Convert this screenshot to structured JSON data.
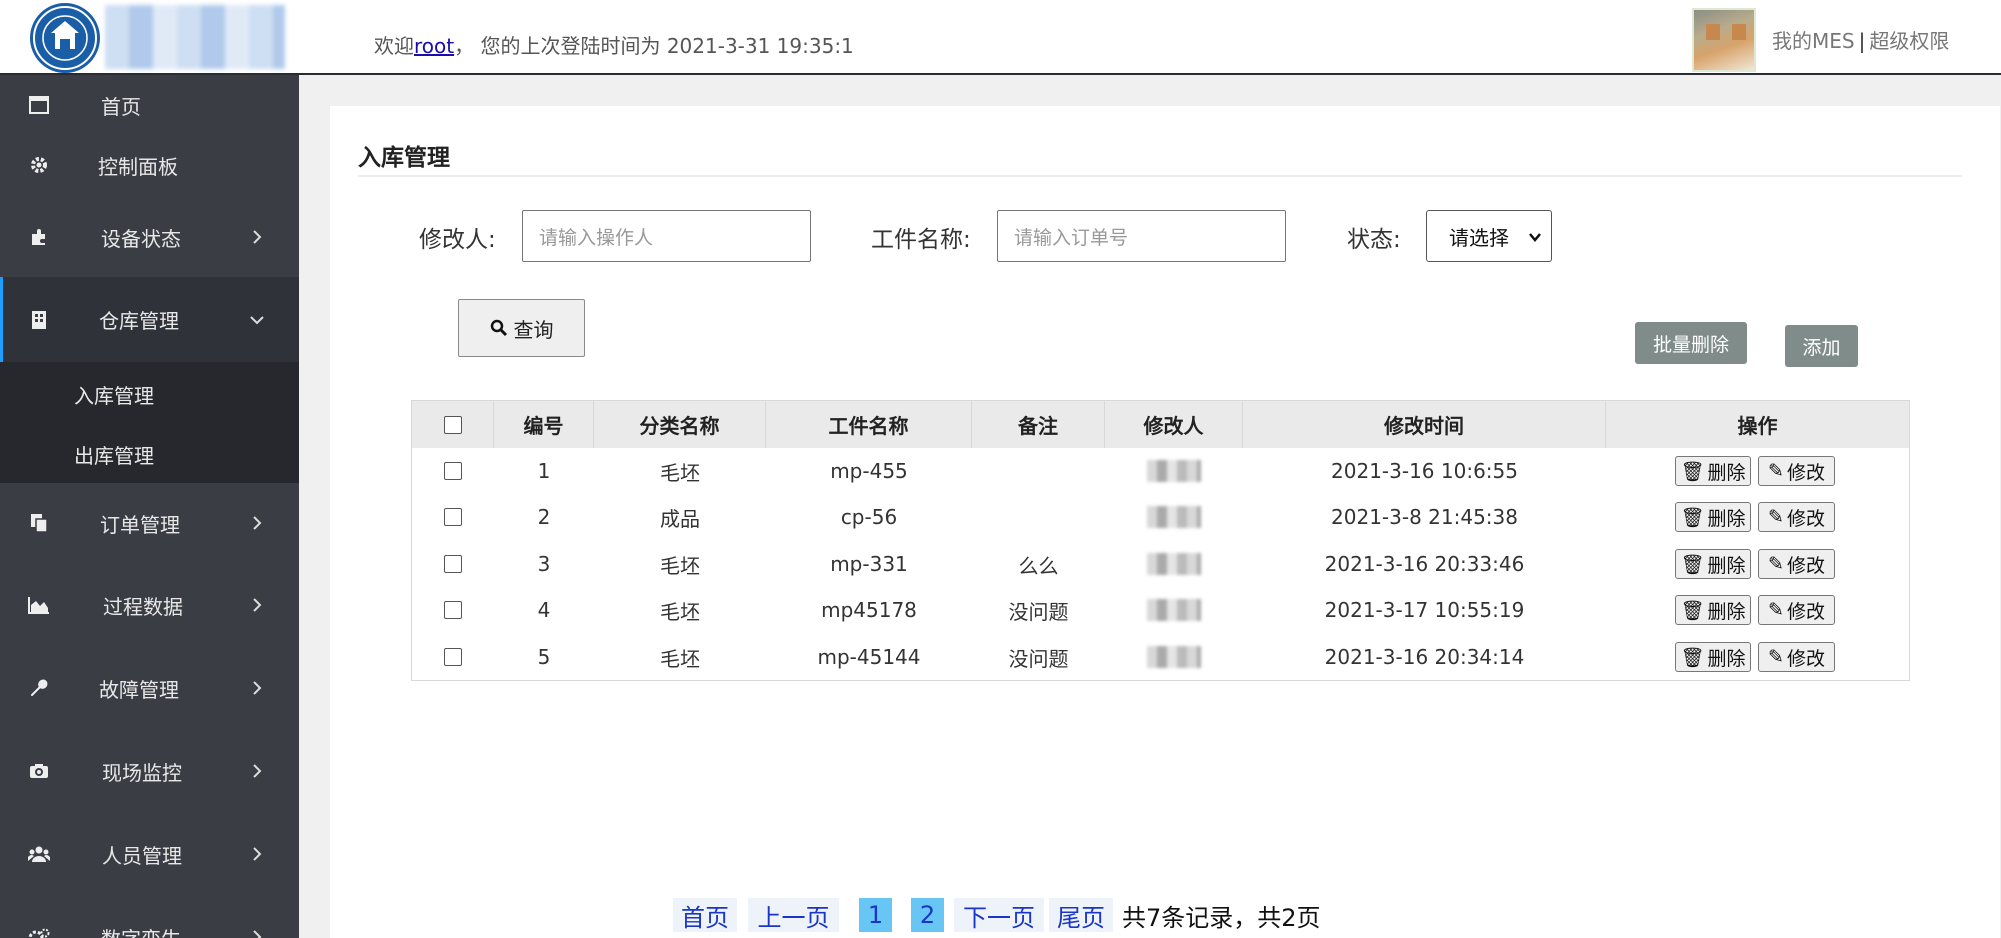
{
  "header": {
    "welcome_prefix": "欢迎",
    "user": "root",
    "welcome_suffix": "， 您的上次登陆时间为 2021-3-31 19:35:1",
    "my_mes": "我的MES",
    "separator": "|",
    "permission": "超级权限"
  },
  "sidebar": {
    "items": [
      {
        "label": "首页",
        "icon": "window-icon"
      },
      {
        "label": "控制面板",
        "icon": "gear-icon"
      },
      {
        "label": "设备状态",
        "icon": "puzzle-icon"
      },
      {
        "label": "仓库管理",
        "icon": "building-icon"
      },
      {
        "label": "订单管理",
        "icon": "copy-icon"
      },
      {
        "label": "过程数据",
        "icon": "area-chart-icon"
      },
      {
        "label": "故障管理",
        "icon": "wrench-icon"
      },
      {
        "label": "现场监控",
        "icon": "camera-icon"
      },
      {
        "label": "人员管理",
        "icon": "users-icon"
      },
      {
        "label": "数字孪生",
        "icon": "gears-icon"
      }
    ],
    "sub_items": [
      "入库管理",
      "出库管理"
    ]
  },
  "page": {
    "title": "入库管理"
  },
  "filters": {
    "modifier_label": "修改人:",
    "modifier_placeholder": "请输入操作人",
    "part_label": "工件名称:",
    "part_placeholder": "请输入订单号",
    "status_label": "状态:",
    "status_value": "请选择"
  },
  "buttons": {
    "query": "查询",
    "batch_delete": "批量删除",
    "add": "添加",
    "delete": "删除",
    "edit": "修改"
  },
  "table": {
    "columns": [
      "编号",
      "分类名称",
      "工件名称",
      "备注",
      "修改人",
      "修改时间",
      "操作"
    ],
    "rows": [
      {
        "id": "1",
        "category": "毛坯",
        "part": "mp-455",
        "note": "",
        "time": "2021-3-16 10:6:55"
      },
      {
        "id": "2",
        "category": "成品",
        "part": "cp-56",
        "note": "",
        "time": "2021-3-8 21:45:38"
      },
      {
        "id": "3",
        "category": "毛坯",
        "part": "mp-331",
        "note": "么么",
        "time": "2021-3-16 20:33:46"
      },
      {
        "id": "4",
        "category": "毛坯",
        "part": "mp45178",
        "note": "没问题",
        "time": "2021-3-17 10:55:19"
      },
      {
        "id": "5",
        "category": "毛坯",
        "part": "mp-45144",
        "note": "没问题",
        "time": "2021-3-16 20:34:14"
      }
    ]
  },
  "pagination": {
    "first": "首页",
    "prev": "上一页",
    "pages": [
      "1",
      "2"
    ],
    "next": "下一页",
    "last": "尾页",
    "summary": "共7条记录，共2页"
  },
  "colors": {
    "sidebar_bg": "#3a3d44",
    "active_accent": "#1e9fff",
    "page_num_bg": "#67c6f3",
    "gray_button": "#7f8c8a"
  }
}
